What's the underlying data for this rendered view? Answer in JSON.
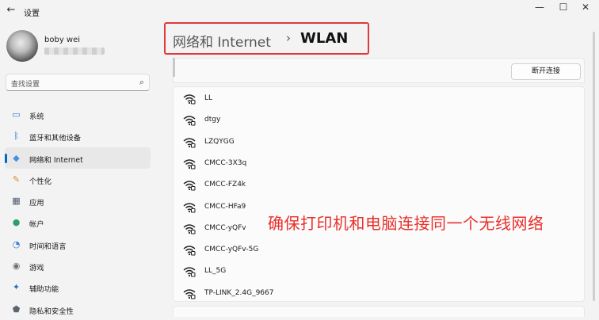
{
  "window": {
    "title": "设置",
    "back_icon": "arrow-left-icon",
    "minimize": "—",
    "maximize": "☐",
    "close": "✕"
  },
  "user": {
    "name": "boby wei"
  },
  "search": {
    "placeholder": "查找设置",
    "icon": "search-icon"
  },
  "sidebar": {
    "items": [
      {
        "label": "系统",
        "icon": "monitor-icon",
        "color": "#3a7bd5",
        "active": false
      },
      {
        "label": "蓝牙和其他设备",
        "icon": "bluetooth-icon",
        "color": "#1f6fcf",
        "active": false
      },
      {
        "label": "网络和 Internet",
        "icon": "wifi-diamond-icon",
        "color": "#4a90e2",
        "active": true
      },
      {
        "label": "个性化",
        "icon": "brush-icon",
        "color": "#d98a2b",
        "active": false
      },
      {
        "label": "应用",
        "icon": "apps-icon",
        "color": "#4c5a6b",
        "active": false
      },
      {
        "label": "帐户",
        "icon": "person-icon",
        "color": "#2e9e6a",
        "active": false
      },
      {
        "label": "时间和语言",
        "icon": "globe-clock-icon",
        "color": "#2b7bd1",
        "active": false
      },
      {
        "label": "游戏",
        "icon": "gamepad-icon",
        "color": "#6d6d6d",
        "active": false
      },
      {
        "label": "辅助功能",
        "icon": "accessibility-icon",
        "color": "#1e6fc4",
        "active": false
      },
      {
        "label": "隐私和安全性",
        "icon": "shield-icon",
        "color": "#5a6470",
        "active": false
      }
    ]
  },
  "breadcrumb": {
    "parent": "网络和 Internet",
    "separator": "›",
    "current": "WLAN"
  },
  "actions": {
    "disconnect_label": "断开连接"
  },
  "networks": [
    {
      "name": "LL"
    },
    {
      "name": "dtgy"
    },
    {
      "name": "LZQYGG"
    },
    {
      "name": "CMCC-3X3q"
    },
    {
      "name": "CMCC-FZ4k"
    },
    {
      "name": "CMCC-HFa9"
    },
    {
      "name": "CMCC-yQFv"
    },
    {
      "name": "CMCC-yQFv-5G"
    },
    {
      "name": "LL_5G"
    },
    {
      "name": "TP-LINK_2.4G_9667"
    }
  ],
  "annotation": {
    "text": "确保打印机和电脑连接同一个无线网络",
    "color": "#e8302b"
  },
  "colors": {
    "accent": "#0067c0",
    "highlight_border": "#e03a3a"
  }
}
